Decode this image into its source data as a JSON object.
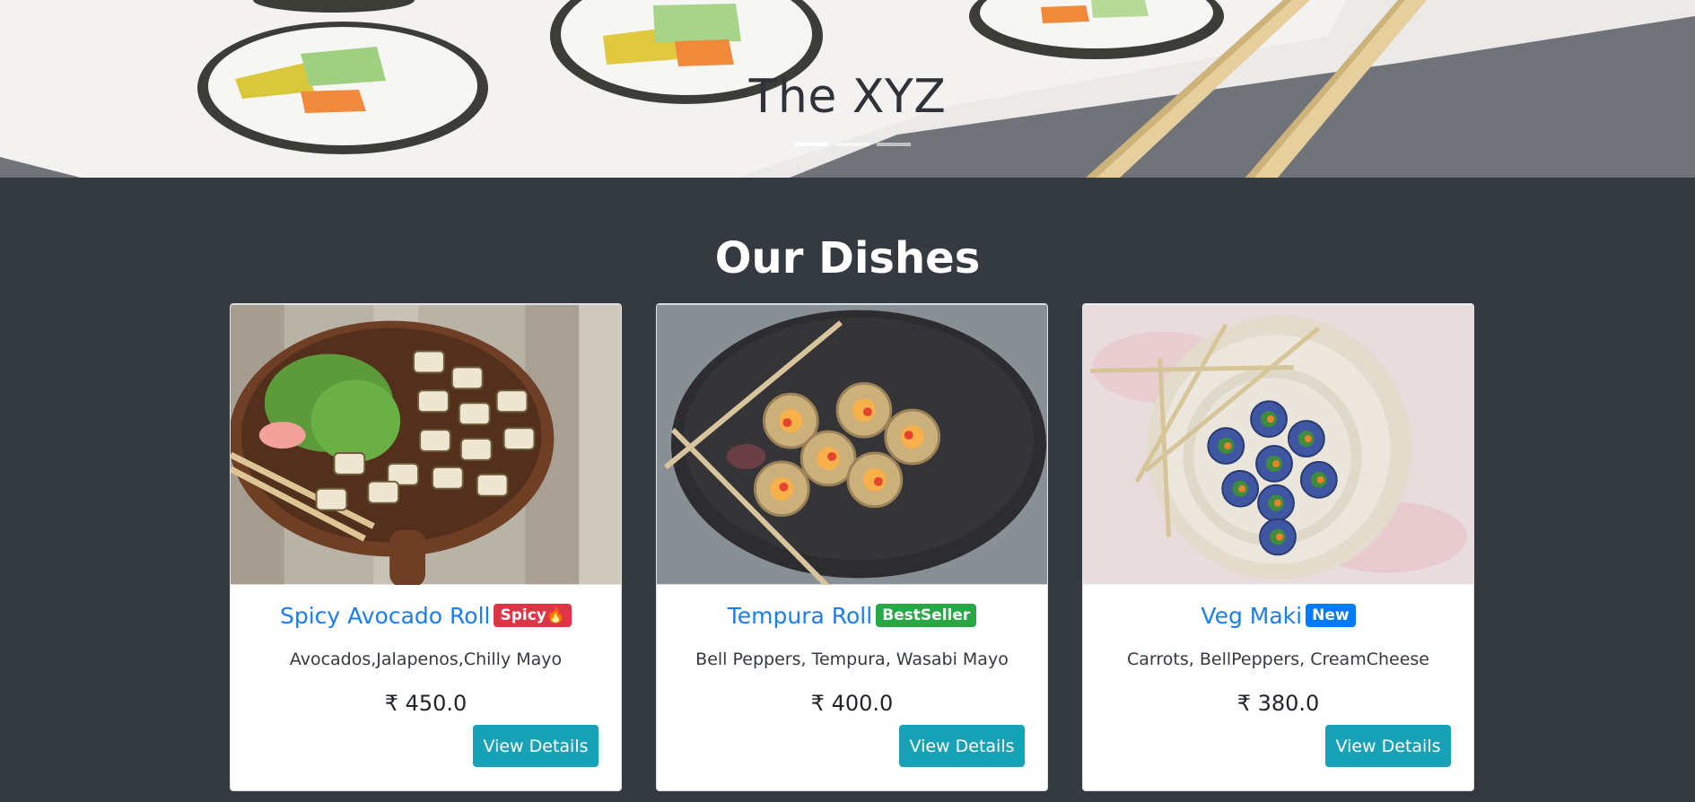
{
  "hero": {
    "title": "The XYZ",
    "indicators": [
      "slide-1",
      "slide-2",
      "slide-3"
    ],
    "active_index": 0
  },
  "section": {
    "title": "Our Dishes"
  },
  "currency": "₹",
  "dishes": [
    {
      "name": "Spicy Avocado Roll",
      "badge": "Spicy🔥",
      "badge_color": "#dc3545",
      "description": "Avocados,Jalapenos,Chilly Mayo",
      "price": "₹ 450.0",
      "button_label": "View Details"
    },
    {
      "name": "Tempura Roll",
      "badge": "BestSeller",
      "badge_color": "#28a745",
      "description": "Bell Peppers, Tempura, Wasabi Mayo",
      "price": "₹ 400.0",
      "button_label": "View Details"
    },
    {
      "name": "Veg Maki",
      "badge": "New",
      "badge_color": "#007bff",
      "description": "Carrots, BellPeppers, CreamCheese",
      "price": "₹ 380.0",
      "button_label": "View Details"
    }
  ],
  "colors": {
    "page_background": "#343a40",
    "link": "#1a7df0",
    "button": "#17a2b8"
  }
}
